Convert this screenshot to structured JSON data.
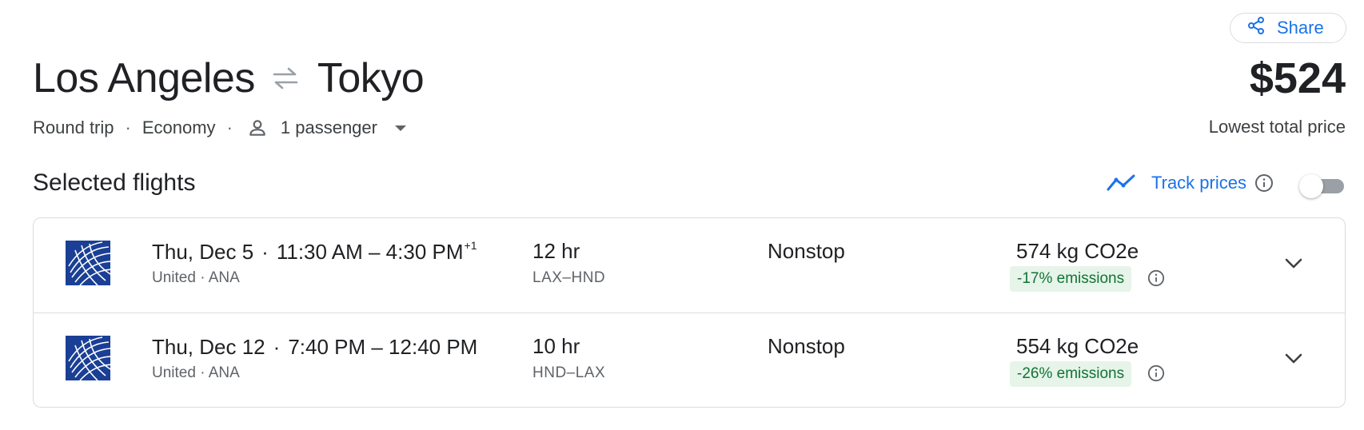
{
  "share": {
    "label": "Share",
    "icon": "share-icon"
  },
  "route": {
    "origin": "Los Angeles",
    "destination": "Tokyo",
    "swap_icon": "swap-arrows-icon"
  },
  "summary": {
    "trip_type": "Round trip",
    "cabin": "Economy",
    "passengers": "1 passenger",
    "separator": "·"
  },
  "price": {
    "value": "$524",
    "label": "Lowest total price"
  },
  "section": {
    "title": "Selected flights"
  },
  "track": {
    "label": "Track prices",
    "enabled": false
  },
  "colors": {
    "accent": "#1a73e8",
    "text": "#202124",
    "muted": "#5f6368",
    "emissions_bg": "#e6f4ea",
    "emissions_text": "#137333",
    "airline_logo": "#1a3f95"
  },
  "flights": [
    {
      "date": "Thu, Dec 5",
      "separator": "·",
      "times": "11:30 AM – 4:30 PM",
      "day_offset": "+1",
      "airlines": "United · ANA",
      "duration": "12 hr",
      "airports": "LAX–HND",
      "stops": "Nonstop",
      "co2": "574 kg CO2e",
      "emissions": "-17% emissions"
    },
    {
      "date": "Thu, Dec 12",
      "separator": "·",
      "times": "7:40 PM – 12:40 PM",
      "day_offset": "",
      "airlines": "United · ANA",
      "duration": "10 hr",
      "airports": "HND–LAX",
      "stops": "Nonstop",
      "co2": "554 kg CO2e",
      "emissions": "-26% emissions"
    }
  ]
}
